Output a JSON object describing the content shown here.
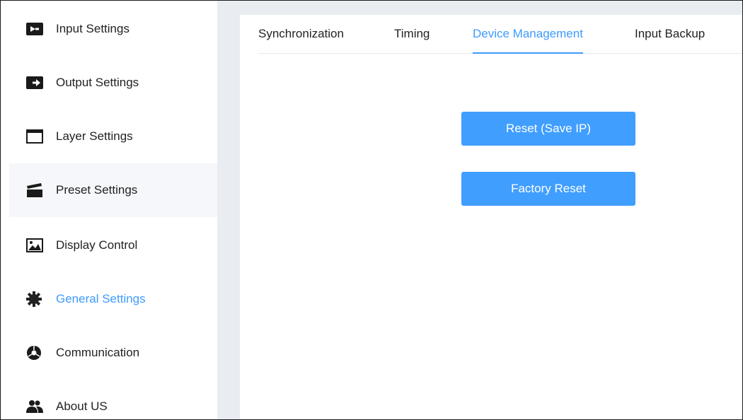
{
  "sidebar": {
    "items": [
      {
        "label": "Input Settings",
        "icon": "input-settings-icon"
      },
      {
        "label": "Output Settings",
        "icon": "output-settings-icon"
      },
      {
        "label": "Layer Settings",
        "icon": "layer-settings-icon"
      },
      {
        "label": "Preset Settings",
        "icon": "preset-settings-icon",
        "hovered": true
      },
      {
        "label": "Display Control",
        "icon": "display-control-icon"
      },
      {
        "label": "General Settings",
        "icon": "gear-icon",
        "active": true
      },
      {
        "label": "Communication",
        "icon": "communication-icon"
      },
      {
        "label": "About US",
        "icon": "users-icon"
      }
    ]
  },
  "main": {
    "tabs": [
      {
        "label": "Synchronization"
      },
      {
        "label": "Timing"
      },
      {
        "label": "Device Management",
        "active": true
      },
      {
        "label": "Input Backup"
      }
    ],
    "buttons": {
      "reset_save_ip": "Reset (Save IP)",
      "factory_reset": "Factory Reset"
    }
  },
  "colors": {
    "accent": "#409eff",
    "active_text": "#3d9bff",
    "sidebar_hover": "#f5f7fa",
    "gutter": "#e9ecf0"
  }
}
